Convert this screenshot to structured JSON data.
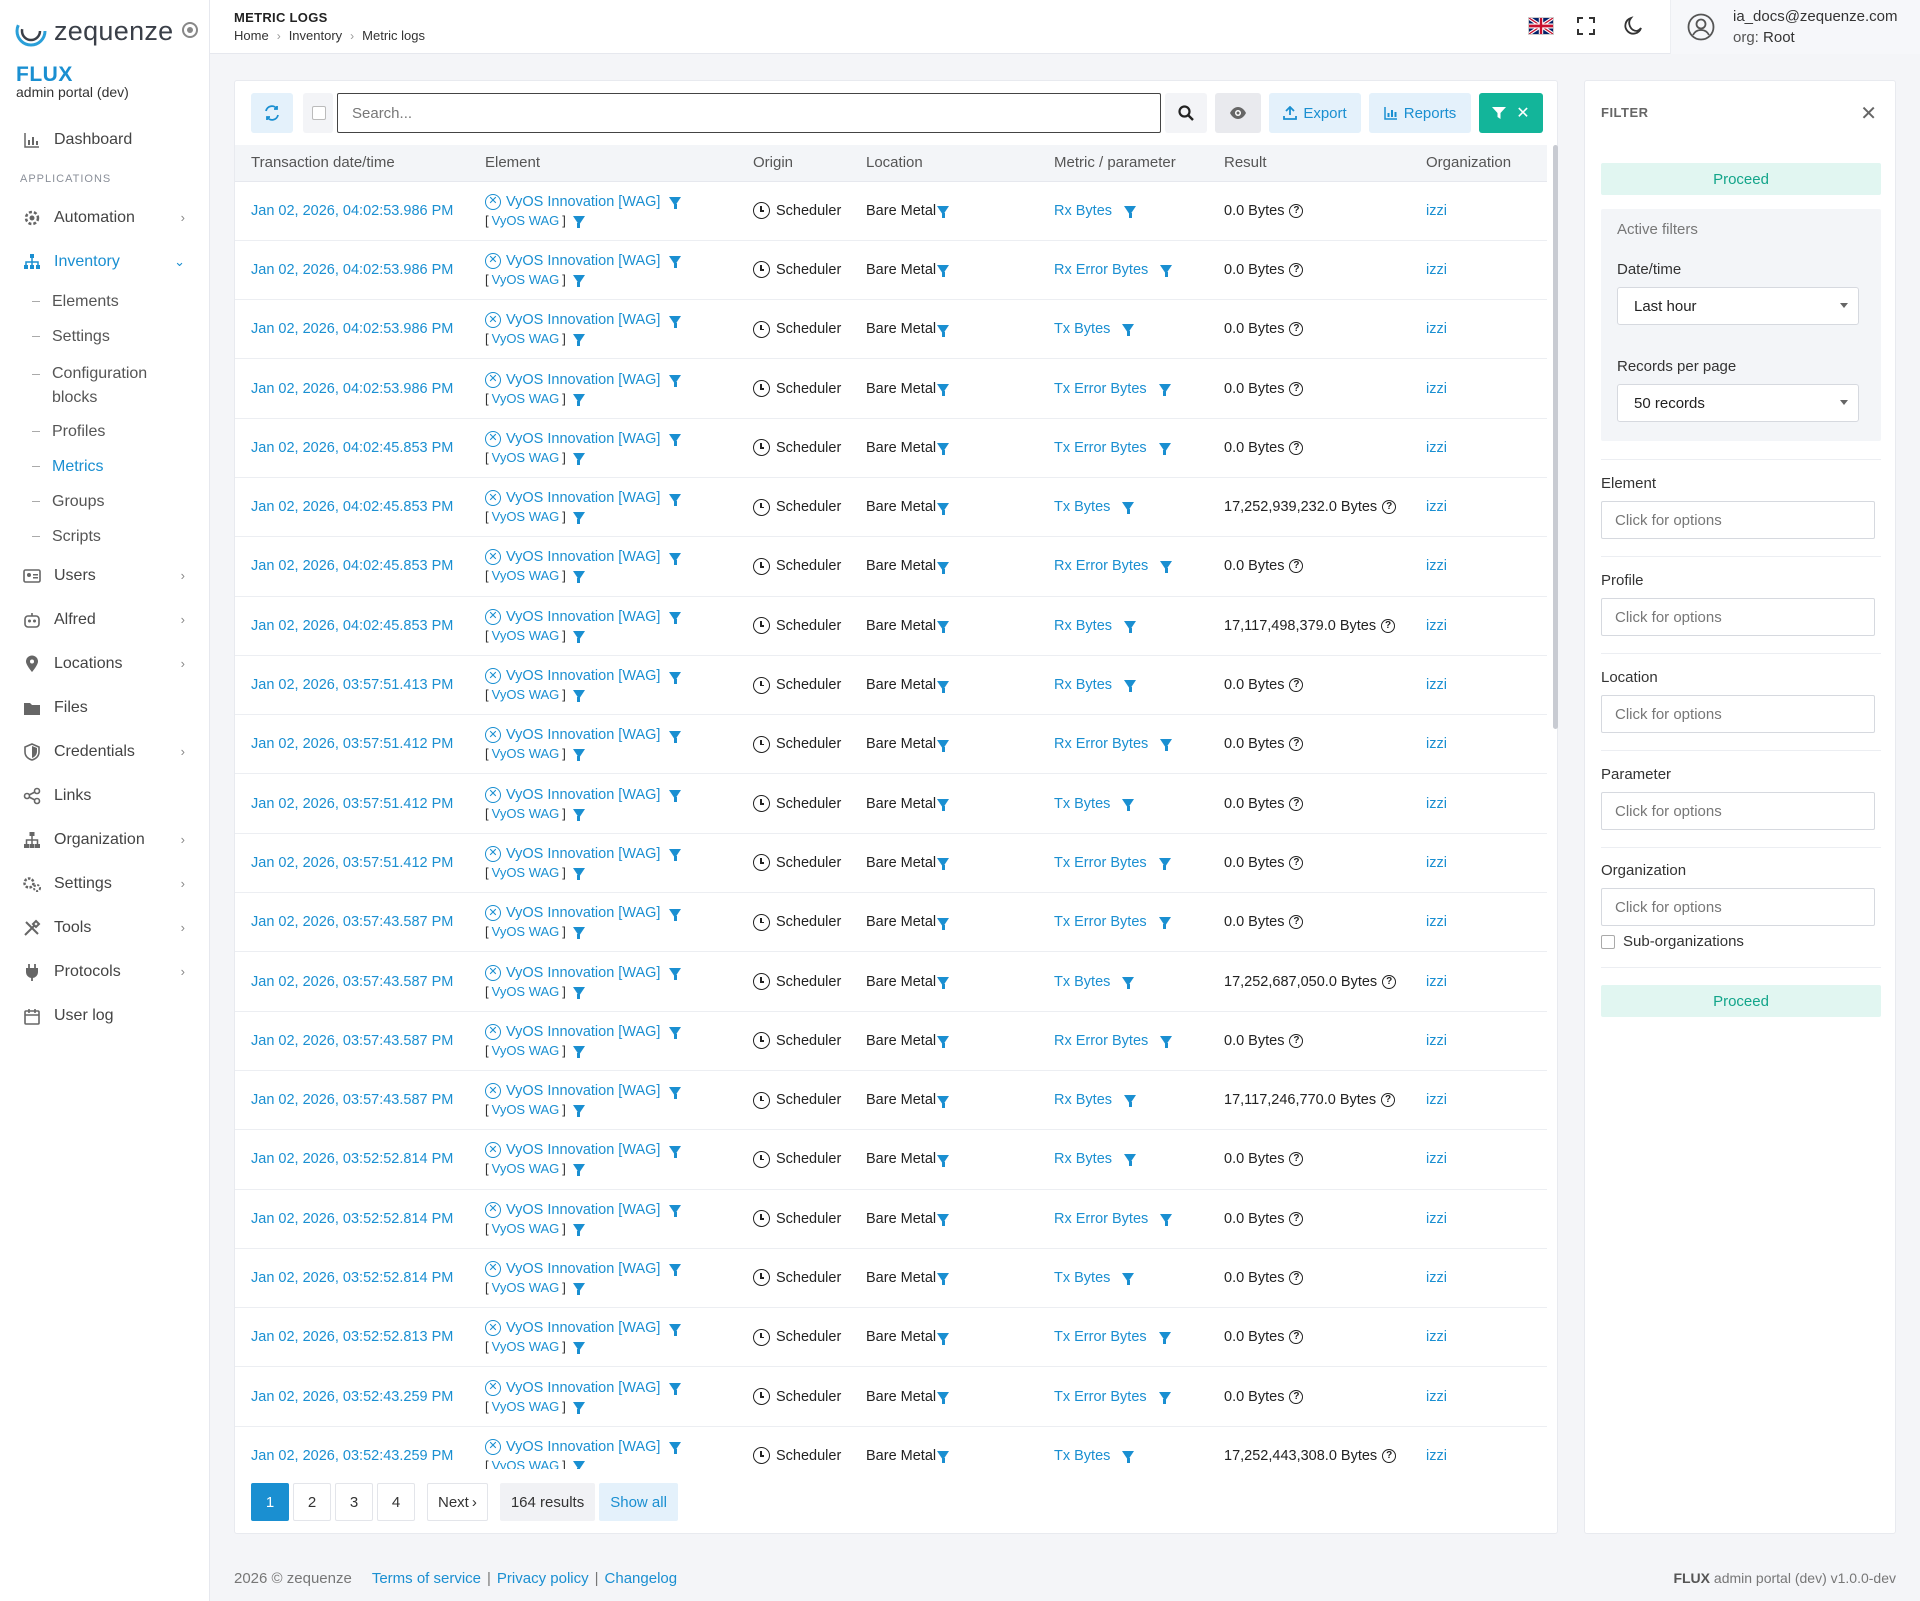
{
  "brand": {
    "logo_text": "zequenze",
    "title": "FLUX",
    "subtitle": "admin portal (dev)"
  },
  "sidebar": {
    "top_items": [
      {
        "label": "Dashboard",
        "icon": "bar-chart-icon"
      }
    ],
    "section_label": "APPLICATIONS",
    "items": [
      {
        "label": "Automation",
        "icon": "gears-icon"
      },
      {
        "label": "Inventory",
        "icon": "sitemap-icon"
      },
      {
        "label": "Users",
        "icon": "id-card-icon"
      },
      {
        "label": "Alfred",
        "icon": "robot-icon"
      },
      {
        "label": "Locations",
        "icon": "map-pin-icon"
      },
      {
        "label": "Files",
        "icon": "folder-icon"
      },
      {
        "label": "Credentials",
        "icon": "shield-icon"
      },
      {
        "label": "Links",
        "icon": "share-nodes-icon"
      },
      {
        "label": "Organization",
        "icon": "org-chart-icon"
      },
      {
        "label": "Settings",
        "icon": "cogs-icon"
      },
      {
        "label": "Tools",
        "icon": "tools-icon"
      },
      {
        "label": "Protocols",
        "icon": "plug-icon"
      },
      {
        "label": "User log",
        "icon": "calendar-icon"
      }
    ],
    "inventory_sub": [
      {
        "label": "Elements"
      },
      {
        "label": "Settings"
      },
      {
        "label": "Configuration blocks"
      },
      {
        "label": "Profiles"
      },
      {
        "label": "Metrics"
      },
      {
        "label": "Groups"
      },
      {
        "label": "Scripts"
      }
    ]
  },
  "header": {
    "title": "METRIC LOGS",
    "breadcrumb": [
      "Home",
      "Inventory",
      "Metric logs"
    ],
    "user_email": "ia_docs@zequenze.com",
    "org_label": "org:",
    "org_value": "Root"
  },
  "toolbar": {
    "search_placeholder": "Search...",
    "export_label": "Export",
    "reports_label": "Reports"
  },
  "table": {
    "columns": [
      "Transaction date/time",
      "Element",
      "Origin",
      "Location",
      "Metric / parameter",
      "Result",
      "Organization"
    ],
    "rows": [
      {
        "dt": "Jan 02, 2026, 04:02:53.986 PM",
        "element": "VyOS Innovation [WAG]",
        "tag": "VyOS WAG",
        "origin": "Scheduler",
        "location": "Bare Metal",
        "metric": "Rx Bytes",
        "result": "0.0 Bytes",
        "org": "izzi"
      },
      {
        "dt": "Jan 02, 2026, 04:02:53.986 PM",
        "element": "VyOS Innovation [WAG]",
        "tag": "VyOS WAG",
        "origin": "Scheduler",
        "location": "Bare Metal",
        "metric": "Rx Error Bytes",
        "result": "0.0 Bytes",
        "org": "izzi"
      },
      {
        "dt": "Jan 02, 2026, 04:02:53.986 PM",
        "element": "VyOS Innovation [WAG]",
        "tag": "VyOS WAG",
        "origin": "Scheduler",
        "location": "Bare Metal",
        "metric": "Tx Bytes",
        "result": "0.0 Bytes",
        "org": "izzi"
      },
      {
        "dt": "Jan 02, 2026, 04:02:53.986 PM",
        "element": "VyOS Innovation [WAG]",
        "tag": "VyOS WAG",
        "origin": "Scheduler",
        "location": "Bare Metal",
        "metric": "Tx Error Bytes",
        "result": "0.0 Bytes",
        "org": "izzi"
      },
      {
        "dt": "Jan 02, 2026, 04:02:45.853 PM",
        "element": "VyOS Innovation [WAG]",
        "tag": "VyOS WAG",
        "origin": "Scheduler",
        "location": "Bare Metal",
        "metric": "Tx Error Bytes",
        "result": "0.0 Bytes",
        "org": "izzi"
      },
      {
        "dt": "Jan 02, 2026, 04:02:45.853 PM",
        "element": "VyOS Innovation [WAG]",
        "tag": "VyOS WAG",
        "origin": "Scheduler",
        "location": "Bare Metal",
        "metric": "Tx Bytes",
        "result": "17,252,939,232.0 Bytes",
        "org": "izzi"
      },
      {
        "dt": "Jan 02, 2026, 04:02:45.853 PM",
        "element": "VyOS Innovation [WAG]",
        "tag": "VyOS WAG",
        "origin": "Scheduler",
        "location": "Bare Metal",
        "metric": "Rx Error Bytes",
        "result": "0.0 Bytes",
        "org": "izzi"
      },
      {
        "dt": "Jan 02, 2026, 04:02:45.853 PM",
        "element": "VyOS Innovation [WAG]",
        "tag": "VyOS WAG",
        "origin": "Scheduler",
        "location": "Bare Metal",
        "metric": "Rx Bytes",
        "result": "17,117,498,379.0 Bytes",
        "org": "izzi"
      },
      {
        "dt": "Jan 02, 2026, 03:57:51.413 PM",
        "element": "VyOS Innovation [WAG]",
        "tag": "VyOS WAG",
        "origin": "Scheduler",
        "location": "Bare Metal",
        "metric": "Rx Bytes",
        "result": "0.0 Bytes",
        "org": "izzi"
      },
      {
        "dt": "Jan 02, 2026, 03:57:51.412 PM",
        "element": "VyOS Innovation [WAG]",
        "tag": "VyOS WAG",
        "origin": "Scheduler",
        "location": "Bare Metal",
        "metric": "Rx Error Bytes",
        "result": "0.0 Bytes",
        "org": "izzi"
      },
      {
        "dt": "Jan 02, 2026, 03:57:51.412 PM",
        "element": "VyOS Innovation [WAG]",
        "tag": "VyOS WAG",
        "origin": "Scheduler",
        "location": "Bare Metal",
        "metric": "Tx Bytes",
        "result": "0.0 Bytes",
        "org": "izzi"
      },
      {
        "dt": "Jan 02, 2026, 03:57:51.412 PM",
        "element": "VyOS Innovation [WAG]",
        "tag": "VyOS WAG",
        "origin": "Scheduler",
        "location": "Bare Metal",
        "metric": "Tx Error Bytes",
        "result": "0.0 Bytes",
        "org": "izzi"
      },
      {
        "dt": "Jan 02, 2026, 03:57:43.587 PM",
        "element": "VyOS Innovation [WAG]",
        "tag": "VyOS WAG",
        "origin": "Scheduler",
        "location": "Bare Metal",
        "metric": "Tx Error Bytes",
        "result": "0.0 Bytes",
        "org": "izzi"
      },
      {
        "dt": "Jan 02, 2026, 03:57:43.587 PM",
        "element": "VyOS Innovation [WAG]",
        "tag": "VyOS WAG",
        "origin": "Scheduler",
        "location": "Bare Metal",
        "metric": "Tx Bytes",
        "result": "17,252,687,050.0 Bytes",
        "org": "izzi"
      },
      {
        "dt": "Jan 02, 2026, 03:57:43.587 PM",
        "element": "VyOS Innovation [WAG]",
        "tag": "VyOS WAG",
        "origin": "Scheduler",
        "location": "Bare Metal",
        "metric": "Rx Error Bytes",
        "result": "0.0 Bytes",
        "org": "izzi"
      },
      {
        "dt": "Jan 02, 2026, 03:57:43.587 PM",
        "element": "VyOS Innovation [WAG]",
        "tag": "VyOS WAG",
        "origin": "Scheduler",
        "location": "Bare Metal",
        "metric": "Rx Bytes",
        "result": "17,117,246,770.0 Bytes",
        "org": "izzi"
      },
      {
        "dt": "Jan 02, 2026, 03:52:52.814 PM",
        "element": "VyOS Innovation [WAG]",
        "tag": "VyOS WAG",
        "origin": "Scheduler",
        "location": "Bare Metal",
        "metric": "Rx Bytes",
        "result": "0.0 Bytes",
        "org": "izzi"
      },
      {
        "dt": "Jan 02, 2026, 03:52:52.814 PM",
        "element": "VyOS Innovation [WAG]",
        "tag": "VyOS WAG",
        "origin": "Scheduler",
        "location": "Bare Metal",
        "metric": "Rx Error Bytes",
        "result": "0.0 Bytes",
        "org": "izzi"
      },
      {
        "dt": "Jan 02, 2026, 03:52:52.814 PM",
        "element": "VyOS Innovation [WAG]",
        "tag": "VyOS WAG",
        "origin": "Scheduler",
        "location": "Bare Metal",
        "metric": "Tx Bytes",
        "result": "0.0 Bytes",
        "org": "izzi"
      },
      {
        "dt": "Jan 02, 2026, 03:52:52.813 PM",
        "element": "VyOS Innovation [WAG]",
        "tag": "VyOS WAG",
        "origin": "Scheduler",
        "location": "Bare Metal",
        "metric": "Tx Error Bytes",
        "result": "0.0 Bytes",
        "org": "izzi"
      },
      {
        "dt": "Jan 02, 2026, 03:52:43.259 PM",
        "element": "VyOS Innovation [WAG]",
        "tag": "VyOS WAG",
        "origin": "Scheduler",
        "location": "Bare Metal",
        "metric": "Tx Error Bytes",
        "result": "0.0 Bytes",
        "org": "izzi"
      },
      {
        "dt": "Jan 02, 2026, 03:52:43.259 PM",
        "element": "VyOS Innovation [WAG]",
        "tag": "VyOS WAG",
        "origin": "Scheduler",
        "location": "Bare Metal",
        "metric": "Tx Bytes",
        "result": "17,252,443,308.0 Bytes",
        "org": "izzi"
      }
    ]
  },
  "pagination": {
    "pages": [
      "1",
      "2",
      "3",
      "4"
    ],
    "current": "1",
    "next_label": "Next",
    "results": "164 results",
    "show_all": "Show all"
  },
  "filter": {
    "title": "FILTER",
    "proceed_label": "Proceed",
    "active_filters_label": "Active filters",
    "datetime_label": "Date/time",
    "datetime_value": "Last hour",
    "records_label": "Records per page",
    "records_value": "50 records",
    "groups": [
      {
        "label": "Element",
        "placeholder": "Click for options"
      },
      {
        "label": "Profile",
        "placeholder": "Click for options"
      },
      {
        "label": "Location",
        "placeholder": "Click for options"
      },
      {
        "label": "Parameter",
        "placeholder": "Click for options"
      },
      {
        "label": "Organization",
        "placeholder": "Click for options"
      }
    ],
    "suborg_label": "Sub-organizations"
  },
  "footer": {
    "copyright": "2026 © zequenze",
    "links": [
      "Terms of service",
      "Privacy policy",
      "Changelog"
    ],
    "version_brand": "FLUX",
    "version_text": "admin portal (dev) v1.0.0-dev"
  },
  "colors": {
    "accent": "#1a8fd1",
    "filter_button": "#13b59a",
    "proceed_bg": "#e1f6f1"
  }
}
